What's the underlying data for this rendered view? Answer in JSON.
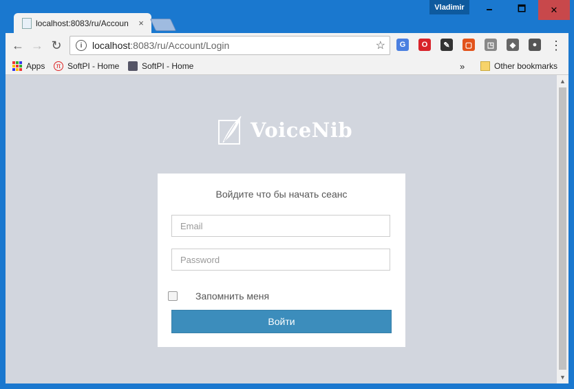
{
  "window": {
    "user": "Vladimir",
    "minimize": "🗕",
    "maximize": "🗖",
    "close": "✕"
  },
  "tab": {
    "title": "localhost:8083/ru/Accoun",
    "close": "×"
  },
  "toolbar": {
    "back": "←",
    "forward": "→",
    "reload": "↻",
    "url_host": "localhost",
    "url_path": ":8083/ru/Account/Login",
    "star": "☆",
    "menu": "⋮"
  },
  "extensions": [
    {
      "name": "google-translate-icon",
      "glyph": "G",
      "color": "#4a7fe0"
    },
    {
      "name": "opera-icon",
      "glyph": "O",
      "color": "#d8232a"
    },
    {
      "name": "eyedropper-icon",
      "glyph": "✎",
      "color": "#333333"
    },
    {
      "name": "office-icon",
      "glyph": "▢",
      "color": "#e2531b"
    },
    {
      "name": "cast-icon",
      "glyph": "◳",
      "color": "#888888"
    },
    {
      "name": "shield-extension-icon",
      "glyph": "◆",
      "color": "#666666"
    },
    {
      "name": "lightbulb-icon",
      "glyph": "●",
      "color": "#555555"
    }
  ],
  "bookmarks": {
    "apps": "Apps",
    "item1": "SoftPI - Home",
    "item2": "SoftPI - Home",
    "more": "»",
    "other": "Other bookmarks"
  },
  "page": {
    "brand": "VoiceNib",
    "login_message": "Войдите что бы начать сеанс",
    "email_placeholder": "Email",
    "password_placeholder": "Password",
    "remember_label": "Запомнить меня",
    "login_button": "Войти"
  },
  "colors": {
    "titlebar": "#1a78cf",
    "content_bg": "#d2d6de",
    "primary_button": "#3c8dbc"
  }
}
